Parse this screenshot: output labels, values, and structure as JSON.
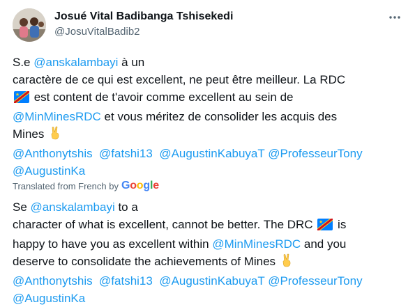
{
  "author": {
    "display_name": "Josué Vital Badibanga Tshisekedi",
    "handle": "@JosuVitalBadib2"
  },
  "icons": {
    "more": "more-horizontal-icon",
    "flag": "drc-flag-icon",
    "victory": "victory-hand-icon"
  },
  "original": {
    "line1_pre": "S.e ",
    "mention_main": "@anskalambayi",
    "line1_post": " à un",
    "line2": "caractère de ce qui est excellent, ne peut être meilleur. La RDC",
    "line3_post": " est content de t'avoir comme excellent au sein de",
    "mention_mines": "@MinMinesRDC",
    "line4_post": "  et vous méritez de consolider les acquis des",
    "line5": "Mines ",
    "tags": [
      "@Anthonytshis",
      "@fatshi13",
      "@AugustinKabuyaT",
      "@ProfesseurTony"
    ],
    "tag_last": "@AugustinKa"
  },
  "translated_label": "Translated from French by",
  "google_letters": [
    "G",
    "o",
    "o",
    "g",
    "l",
    "e"
  ],
  "google_colors": [
    "#4285F4",
    "#EA4335",
    "#FBBC05",
    "#4285F4",
    "#34A853",
    "#EA4335"
  ],
  "translation": {
    "line1_pre": "Se ",
    "mention_main": "@anskalambayi",
    "line1_post": " to a",
    "line2_pre": "character of what is excellent, cannot be better. The DRC ",
    "line2_post": " is",
    "line3_pre": "happy to have you as excellent within ",
    "mention_mines": "@MinMinesRDC",
    "line3_post": " and you",
    "line4": "deserve to consolidate the achievements of Mines ",
    "tags": [
      "@Anthonytshis",
      "@fatshi13",
      "@AugustinKabuyaT",
      "@ProfesseurTony"
    ],
    "tag_last": "@AugustinKa"
  },
  "colors": {
    "link": "#1d9bf0",
    "text": "#0f1419",
    "secondary": "#536471"
  }
}
